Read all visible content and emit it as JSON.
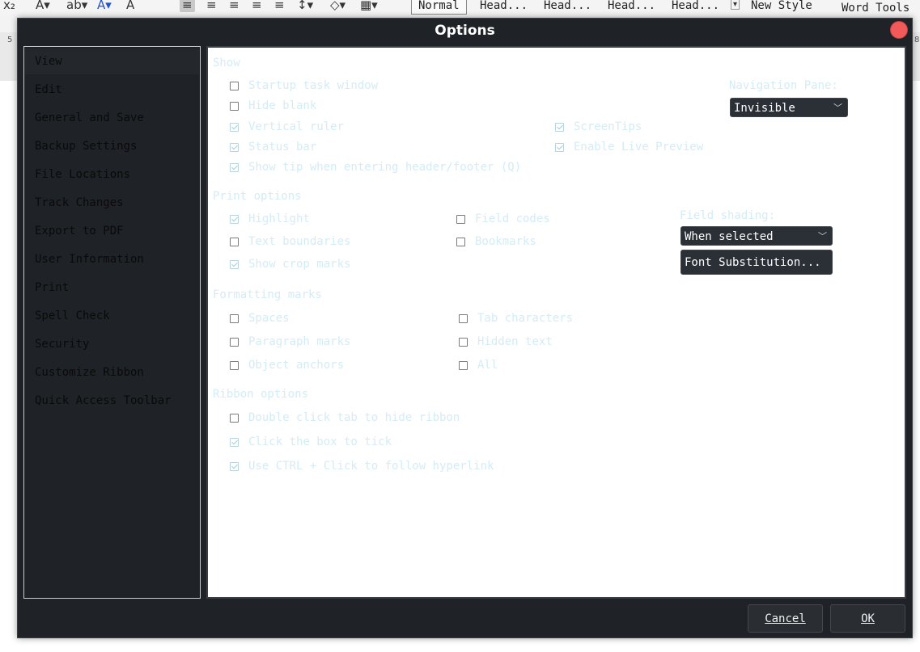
{
  "toolbar": {
    "styles": [
      "Normal",
      "Head...",
      "Head...",
      "Head...",
      "Head..."
    ],
    "new_style": "New Style",
    "word_tools": "Word Tools"
  },
  "ruler": {
    "left_number": "5",
    "right_number": "8"
  },
  "dialog": {
    "title": "Options",
    "nav": [
      "View",
      "Edit",
      "General and Save",
      "Backup Settings",
      "File Locations",
      "Track Changes",
      "Export to PDF",
      "User Information",
      "Print",
      "Spell Check",
      "Security",
      "Customize Ribbon",
      "Quick Access Toolbar"
    ],
    "selected_nav": "View",
    "show": {
      "heading": "Show",
      "startup_task_window": "Startup task window",
      "hide_blank": "Hide blank",
      "vertical_ruler": "Vertical ruler",
      "status_bar": "Status bar",
      "show_tip": "Show tip when entering header/footer (Q)",
      "screentips": "ScreenTips",
      "enable_live_preview": "Enable Live Preview",
      "nav_pane_label": "Navigation Pane:",
      "nav_pane_value": "Invisible"
    },
    "print": {
      "heading": "Print options",
      "highlight": "Highlight",
      "text_boundaries": "Text boundaries",
      "show_crop_marks": "Show crop marks",
      "field_codes": "Field codes",
      "bookmarks": "Bookmarks",
      "field_shading_label": "Field shading:",
      "field_shading_value": "When selected",
      "font_substitution": "Font Substitution..."
    },
    "formatting": {
      "heading": "Formatting marks",
      "spaces": "Spaces",
      "paragraph_marks": "Paragraph marks",
      "object_anchors": "Object anchors",
      "tab_characters": "Tab characters",
      "hidden_text": "Hidden text",
      "all": "All"
    },
    "ribbon": {
      "heading": "Ribbon options",
      "double_click": "Double click tab to hide ribbon",
      "click_box": "Click the box to tick",
      "ctrl_click": "Use CTRL + Click to follow hyperlink"
    },
    "cancel": "Cancel",
    "ok": "OK"
  },
  "colors": {
    "dialog_bg": "#1f2226",
    "label_text": "#d4ecf5",
    "close_button": "#f25a5a"
  }
}
